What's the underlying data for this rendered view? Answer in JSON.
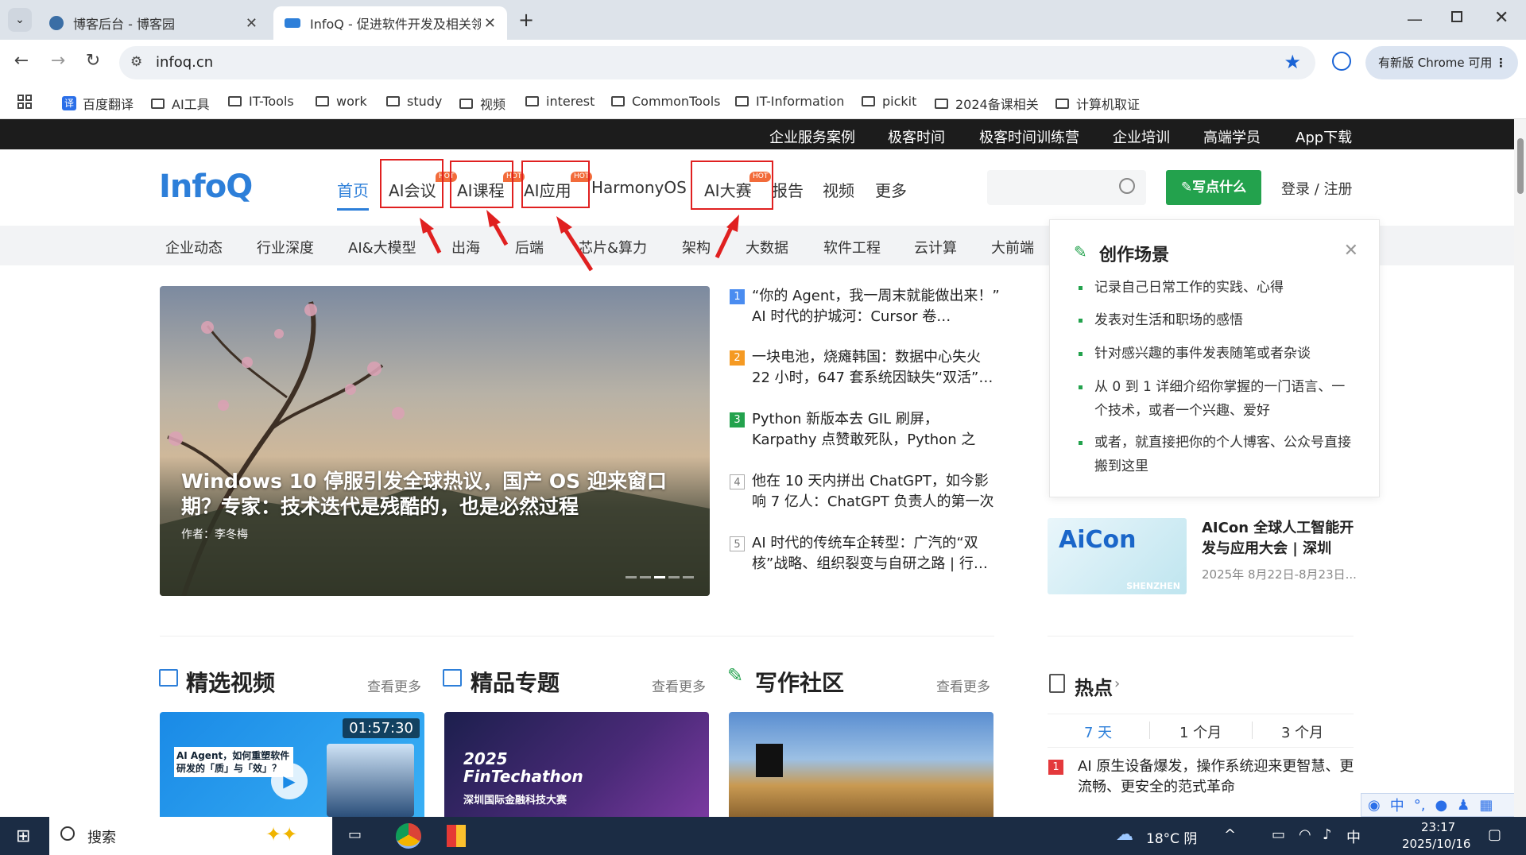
{
  "browser": {
    "tabs": [
      {
        "title": "博客后台 - 博客园",
        "active": false
      },
      {
        "title": "InfoQ - 促进软件开发及相关领",
        "active": true
      }
    ],
    "url": "infoq.cn",
    "update_button": "有新版 Chrome 可用",
    "bookmarks": [
      "百度翻译",
      "AI工具",
      "IT-Tools",
      "work",
      "study",
      "视频",
      "interest",
      "CommonTools",
      "IT-Information",
      "pickit",
      "2024备课相关",
      "计算机取证"
    ]
  },
  "topbar": [
    "企业服务案例",
    "极客时间",
    "极客时间训练营",
    "企业培训",
    "高端学员",
    "App下载"
  ],
  "header": {
    "logo": "InfoQ",
    "nav": [
      "首页",
      "AI会议",
      "AI课程",
      "AI应用",
      "HarmonyOS",
      "AI大赛",
      "报告",
      "视频",
      "更多"
    ],
    "hot_badge": "HOT",
    "write_button": "✎写点什么",
    "login": "登录 / 注册"
  },
  "subnav": [
    "企业动态",
    "行业深度",
    "AI&大模型",
    "出海",
    "后端",
    "芯片&算力",
    "架构",
    "大数据",
    "软件工程",
    "云计算",
    "大前端"
  ],
  "hero": {
    "title": "Windows 10 停服引发全球热议，国产 OS 迎来窗口期？专家：技术迭代是残酷的，也是必然过程",
    "author": "作者：李冬梅"
  },
  "news": [
    {
      "num": "1",
      "text": "“你的 Agent，我一周末就能做出来！” AI 时代的护城河：Cursor 卷…",
      "color": "#4a8cf0"
    },
    {
      "num": "2",
      "text": "一块电池，烧瘫韩国：数据中心失火 22 小时，647 套系统因缺失“双活”…",
      "color": "#f59a23"
    },
    {
      "num": "3",
      "text": "Python 新版本去 GIL 刷屏，Karpathy 点赞敢死队，Python 之父：冷静，…",
      "color": "#23a24d"
    },
    {
      "num": "4",
      "text": "他在 10 天内拼出 ChatGPT，如今影响 7 亿人：ChatGPT 负责人的第一次讲述",
      "color": ""
    },
    {
      "num": "5",
      "text": "AI 时代的传统车企转型：广汽的“双核”战略、组织裂变与自研之路 | 行…",
      "color": ""
    }
  ],
  "popup": {
    "title": "创作场景",
    "items": [
      "记录自己日常工作的实践、心得",
      "发表对生活和职场的感悟",
      "针对感兴趣的事件发表随笔或者杂谈",
      "从 0 到 1 详细介绍你掌握的一门语言、一个技术，或者一个兴趣、爱好",
      "或者，就直接把你的个人博客、公众号直接搬到这里"
    ]
  },
  "aicon": {
    "title": "AICon 全球人工智能开发与应用大会 | 深圳",
    "date": "2025年 8月22日-8月23日...",
    "logo": "AiCon",
    "city": "SHENZHEN"
  },
  "sections": {
    "video": "精选视频",
    "topics": "精品专题",
    "writing": "写作社区",
    "more": "查看更多",
    "hot": "热点"
  },
  "cards": {
    "video_time": "01:57:30",
    "video_text": "AI Agent，如何重塑软件研发的「质」与「效」？",
    "fintech": "2025 FinTechathon",
    "fintech_sub": "深圳国际金融科技大赛"
  },
  "hot_tabs": [
    "7 天",
    "1 个月",
    "3 个月"
  ],
  "hot_item": {
    "num": "1",
    "text": "AI 原生设备爆发，操作系统迎来更智慧、更流畅、更安全的范式革命"
  },
  "taskbar": {
    "search": "搜索",
    "weather": "18°C 阴",
    "ime": "中",
    "time": "23:17",
    "date": "2025/10/16"
  },
  "colors": {
    "accent": "#2d7fd9",
    "green": "#23a24d",
    "hot": "#f26b3a",
    "red_box": "#e02020"
  }
}
